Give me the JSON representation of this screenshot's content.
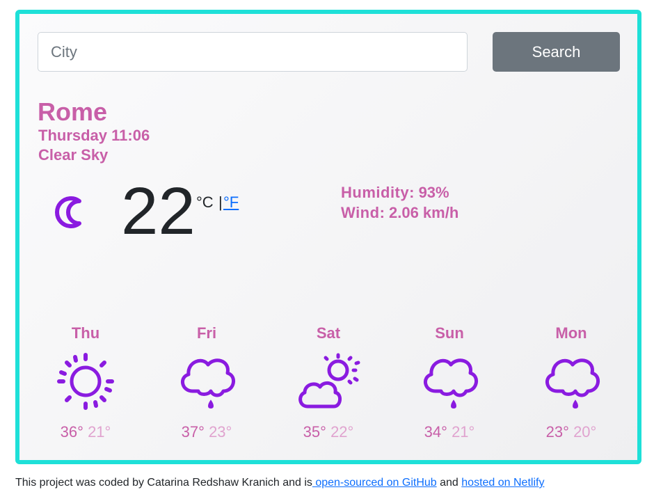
{
  "search": {
    "placeholder": "City",
    "button_label": "Search"
  },
  "current": {
    "city": "Rome",
    "datetime": "Thursday 11:06",
    "description": "Clear Sky",
    "icon": "moon-icon",
    "temperature": "22",
    "unit_celsius": "°C",
    "unit_separator": "|",
    "unit_fahrenheit": "°F",
    "humidity_label": "Humidity",
    "humidity_value": ": 93%",
    "wind_label": "Wind",
    "wind_value": ": 2.06 km/h"
  },
  "forecast": [
    {
      "day": "Thu",
      "icon": "sun-icon",
      "max": "36°",
      "min": "21°"
    },
    {
      "day": "Fri",
      "icon": "rain-cloud-icon",
      "max": "37°",
      "min": "23°"
    },
    {
      "day": "Sat",
      "icon": "partly-cloudy-icon",
      "max": "35°",
      "min": "22°"
    },
    {
      "day": "Sun",
      "icon": "rain-cloud-icon",
      "max": "34°",
      "min": "21°"
    },
    {
      "day": "Mon",
      "icon": "rain-cloud-icon",
      "max": "23°",
      "min": "20°"
    }
  ],
  "footer": {
    "text_before": "This project was coded by Catarina Redshaw Kranich and is",
    "github_link": " open-sourced on GitHub",
    "text_middle": " and ",
    "netlify_link": "hosted on Netlify"
  },
  "colors": {
    "accent": "#c85fa8",
    "icon": "#8a1be0",
    "border": "#1ee0d8",
    "button": "#6c757d",
    "link": "#0d6efd"
  }
}
